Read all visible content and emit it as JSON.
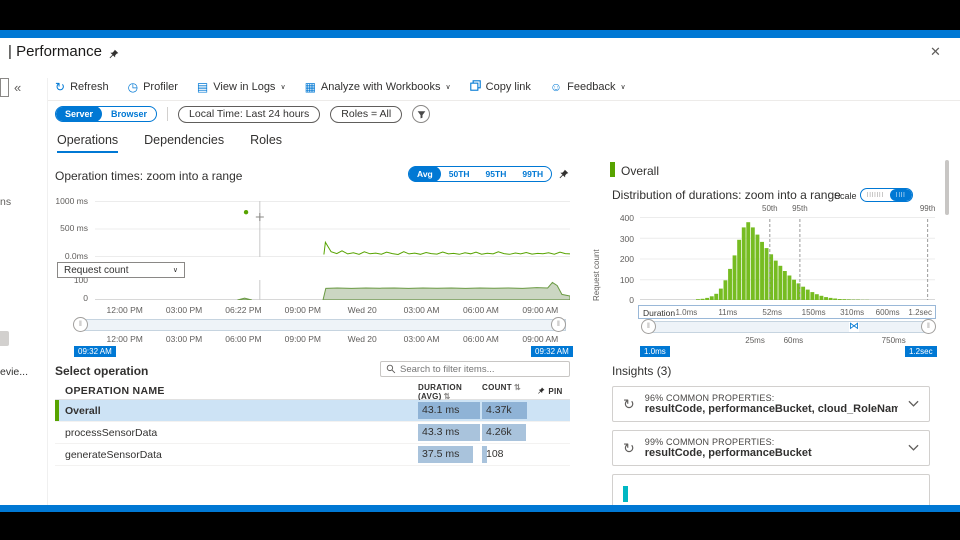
{
  "icons": {
    "collapse": "«",
    "refresh": "↻",
    "profiler": "◷",
    "logs": "▤",
    "workbooks": "▦",
    "feedback": "☺",
    "caret_down": "∨",
    "close": "✕",
    "sync": "↻",
    "grip": "‖",
    "sort": "⇅",
    "range_collapse": "⋈"
  },
  "page": {
    "title": "| Performance"
  },
  "sidebar": {
    "fragment_top": "ns",
    "fragment_bottom": "evie..."
  },
  "toolbar": {
    "refresh": "Refresh",
    "profiler": "Profiler",
    "view_in_logs": "View in Logs",
    "analyze_with_workbooks": "Analyze with Workbooks",
    "copy_link": "Copy link",
    "feedback": "Feedback"
  },
  "filters": {
    "server": "Server",
    "browser": "Browser",
    "local_time": "Local Time: Last 24 hours",
    "roles": "Roles = All"
  },
  "tabs": {
    "operations": "Operations",
    "dependencies": "Dependencies",
    "roles": "Roles"
  },
  "operation_times": {
    "title": "Operation times: zoom into a range",
    "metrics": {
      "avg": "Avg",
      "p50": "50TH",
      "p95": "95TH",
      "p99": "99TH"
    },
    "dropdown": "Request count",
    "brush_start": "09:32 AM",
    "brush_end": "09:32 AM"
  },
  "select_operation": {
    "label": "Select operation",
    "search_placeholder": "Search to filter items...",
    "table": {
      "col_name": "OPERATION NAME",
      "col_duration": "DURATION (AVG)",
      "col_count": "COUNT",
      "col_pin": "PIN",
      "rows": [
        {
          "name": "Overall",
          "duration": "43.1 ms",
          "count": "4.37k",
          "duration_bar": 0.97,
          "count_bar": 0.94
        },
        {
          "name": "processSensorData",
          "duration": "43.3 ms",
          "count": "4.26k",
          "duration_bar": 0.97,
          "count_bar": 0.92
        },
        {
          "name": "generateSensorData",
          "duration": "37.5 ms",
          "count": "108",
          "duration_bar": 0.86,
          "count_bar": 0.1
        }
      ]
    }
  },
  "distribution": {
    "legend": "Overall",
    "title": "Distribution of durations: zoom into a range",
    "scale_label": "Scale",
    "scale_left_ticks": "|||||||",
    "scale_right_ticks": "||||",
    "axis_label": "Duration",
    "brush_start": "1.0ms",
    "brush_end": "1.2sec"
  },
  "insights": {
    "title": "Insights (3)",
    "cards": [
      {
        "heading": "96% COMMON PROPERTIES:",
        "detail": "resultCode, performanceBucket, cloud_RoleName"
      },
      {
        "heading": "99% COMMON PROPERTIES:",
        "detail": "resultCode, performanceBucket"
      }
    ]
  },
  "chart_data": [
    {
      "id": "operation-times",
      "type": "line",
      "title": "Operation times: zoom into a range",
      "ylim": [
        0,
        1000
      ],
      "ytick_labels": [
        "1000 ms",
        "500 ms",
        "0.0ms"
      ],
      "x_labels": [
        "12:00 PM",
        "03:00 PM",
        "06:22 PM",
        "09:00 PM",
        "Wed 20",
        "03:00 AM",
        "06:00 AM",
        "09:00 AM"
      ],
      "line_color": "#57a300",
      "hover_line_frac": 0.347,
      "outlier": {
        "frac": 0.318,
        "value": 800
      },
      "points": [
        [
          0.482,
          45
        ],
        [
          0.485,
          265
        ],
        [
          0.497,
          95
        ],
        [
          0.509,
          60
        ],
        [
          0.52,
          110
        ],
        [
          0.532,
          55
        ],
        [
          0.544,
          75
        ],
        [
          0.556,
          48
        ],
        [
          0.567,
          92
        ],
        [
          0.579,
          58
        ],
        [
          0.591,
          70
        ],
        [
          0.603,
          50
        ],
        [
          0.614,
          85
        ],
        [
          0.626,
          60
        ],
        [
          0.638,
          45
        ],
        [
          0.65,
          95
        ],
        [
          0.661,
          55
        ],
        [
          0.673,
          70
        ],
        [
          0.685,
          48
        ],
        [
          0.697,
          80
        ],
        [
          0.708,
          60
        ],
        [
          0.72,
          52
        ],
        [
          0.732,
          90
        ],
        [
          0.744,
          55
        ],
        [
          0.755,
          65
        ],
        [
          0.767,
          48
        ],
        [
          0.779,
          75
        ],
        [
          0.791,
          58
        ],
        [
          0.802,
          85
        ],
        [
          0.814,
          50
        ],
        [
          0.826,
          68
        ],
        [
          0.838,
          55
        ],
        [
          0.849,
          92
        ],
        [
          0.861,
          60
        ],
        [
          0.873,
          48
        ],
        [
          0.885,
          72
        ],
        [
          0.896,
          55
        ],
        [
          0.908,
          80
        ],
        [
          0.92,
          52
        ],
        [
          0.932,
          65
        ],
        [
          0.943,
          58
        ],
        [
          0.955,
          75
        ],
        [
          0.967,
          50
        ],
        [
          0.979,
          85
        ],
        [
          0.99,
          60
        ],
        [
          1,
          55
        ]
      ]
    },
    {
      "id": "request-count",
      "type": "area",
      "ylim": [
        0,
        100
      ],
      "ytick_labels": [
        "100",
        "0"
      ],
      "x_labels": [
        "12:00 PM",
        "03:00 PM",
        "06:00 PM",
        "09:00 PM",
        "Wed 20",
        "03:00 AM",
        "06:00 AM",
        "09:00 AM"
      ],
      "fill_color": "rgba(124,153,103,0.4)",
      "line_color": "#6a9a43",
      "points": [
        [
          0.48,
          0
        ],
        [
          0.486,
          58
        ],
        [
          0.51,
          60
        ],
        [
          0.54,
          58
        ],
        [
          0.57,
          60
        ],
        [
          0.6,
          59
        ],
        [
          0.63,
          60
        ],
        [
          0.66,
          58
        ],
        [
          0.69,
          60
        ],
        [
          0.72,
          59
        ],
        [
          0.75,
          60
        ],
        [
          0.78,
          58
        ],
        [
          0.81,
          60
        ],
        [
          0.84,
          59
        ],
        [
          0.87,
          60
        ],
        [
          0.9,
          58
        ],
        [
          0.93,
          62
        ],
        [
          0.953,
          60
        ],
        [
          0.963,
          88
        ],
        [
          0.973,
          72
        ],
        [
          0.983,
          28
        ],
        [
          1,
          20
        ]
      ],
      "bump": [
        [
          0.3,
          0
        ],
        [
          0.315,
          9
        ],
        [
          0.33,
          0
        ]
      ]
    },
    {
      "id": "duration-distribution",
      "type": "histogram",
      "title": "Distribution of durations: zoom into a range",
      "ylabel": "Request count",
      "ylim": [
        0,
        400
      ],
      "ytick_labels": [
        "400",
        "300",
        "200",
        "100",
        "0"
      ],
      "bar_color": "#76bc21",
      "bars": {
        "start_frac": 0.19,
        "bar_frac": 0.0155,
        "heights": [
          4,
          6,
          10,
          18,
          30,
          55,
          95,
          150,
          215,
          290,
          350,
          375,
          350,
          315,
          280,
          250,
          220,
          190,
          165,
          140,
          118,
          98,
          80,
          64,
          50,
          38,
          28,
          20,
          14,
          10,
          7,
          5,
          4,
          3,
          2,
          2,
          1,
          1
        ]
      },
      "percentiles": [
        {
          "label": "50th",
          "frac": 0.44
        },
        {
          "label": "95th",
          "frac": 0.542
        },
        {
          "label": "99th",
          "frac": 0.975
        }
      ],
      "x_ticks": [
        {
          "label": "1.0ms",
          "pos": 0.16
        },
        {
          "label": "11ms",
          "pos": 0.3
        },
        {
          "label": "52ms",
          "pos": 0.45
        },
        {
          "label": "150ms",
          "pos": 0.59
        },
        {
          "label": "310ms",
          "pos": 0.72
        },
        {
          "label": "600ms",
          "pos": 0.84
        },
        {
          "label": "1.2sec",
          "pos": 0.95
        }
      ],
      "brush_labels": [
        {
          "label": "25ms",
          "pos": 0.39
        },
        {
          "label": "60ms",
          "pos": 0.52
        },
        {
          "label": "750ms",
          "pos": 0.86
        }
      ]
    }
  ]
}
